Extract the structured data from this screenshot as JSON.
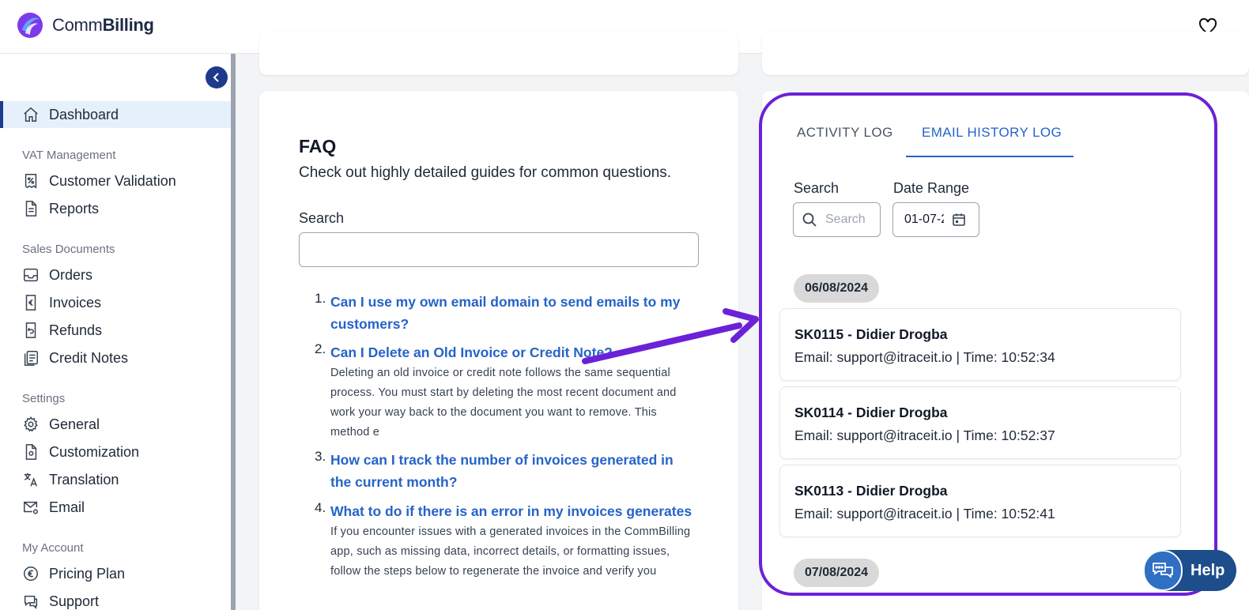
{
  "brand": {
    "name_prefix": "Comm",
    "name_suffix": "Billing"
  },
  "sidebar": {
    "dashboard": "Dashboard",
    "sections": {
      "vat": "VAT Management",
      "sales": "Sales Documents",
      "settings": "Settings",
      "account": "My Account"
    },
    "items": {
      "customer_validation": "Customer Validation",
      "reports": "Reports",
      "orders": "Orders",
      "invoices": "Invoices",
      "refunds": "Refunds",
      "credit_notes": "Credit Notes",
      "general": "General",
      "customization": "Customization",
      "translation": "Translation",
      "email": "Email",
      "pricing_plan": "Pricing Plan",
      "support": "Support"
    }
  },
  "faq": {
    "title": "FAQ",
    "subtitle": "Check out highly detailed guides for common questions.",
    "search_label": "Search",
    "items": [
      {
        "num": "1.",
        "question": "Can I use my own email domain to send emails to my customers?",
        "answer": ""
      },
      {
        "num": "2.",
        "question": "Can I Delete an Old Invoice or Credit Note?",
        "answer": "Deleting an old invoice or credit note follows the same sequential process. You must start by deleting the most recent document and work your way back to the document you want to remove. This method e"
      },
      {
        "num": "3.",
        "question": "How can I track the number of invoices generated in the current month?",
        "answer": ""
      },
      {
        "num": "4.",
        "question": "What to do if there is an error in my invoices generates",
        "answer": "If you encounter issues with a generated invoices in the CommBilling app, such as missing data, incorrect details, or formatting issues, follow the steps below to regenerate the invoice and verify you"
      }
    ]
  },
  "log": {
    "tabs": {
      "activity": "ACTIVITY LOG",
      "email": "EMAIL HISTORY LOG"
    },
    "search_label": "Search",
    "search_placeholder": "Search",
    "date_label": "Date Range",
    "date_value": "01-07-2",
    "groups": [
      {
        "date": "06/08/2024",
        "entries": [
          {
            "title": "SK0115 - Didier Drogba",
            "detail": "Email: support@itraceit.io | Time: 10:52:34"
          },
          {
            "title": "SK0114 - Didier Drogba",
            "detail": "Email: support@itraceit.io | Time: 10:52:37"
          },
          {
            "title": "SK0113 - Didier Drogba",
            "detail": "Email: support@itraceit.io | Time: 10:52:41"
          }
        ]
      },
      {
        "date": "07/08/2024",
        "entries": []
      }
    ]
  },
  "help": {
    "label": "Help"
  },
  "colors": {
    "accent": "#2563c9",
    "highlight": "#6b21d8",
    "nav_active_bg": "#e6f0fb"
  }
}
